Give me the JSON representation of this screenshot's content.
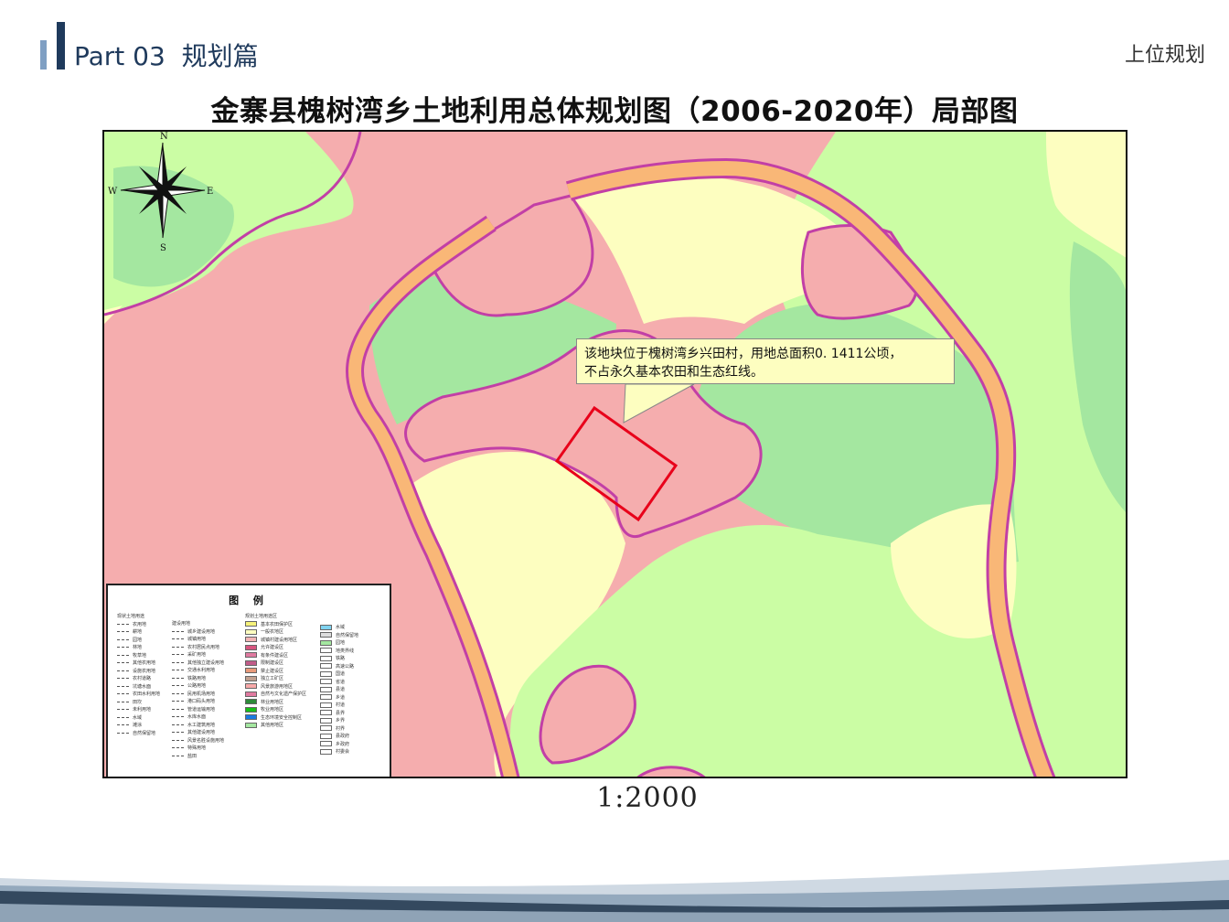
{
  "header": {
    "section": "Part 03",
    "section_title": "规划篇",
    "right_label": "上位规划"
  },
  "map": {
    "title": "金寨县槐树湾乡土地利用总体规划图（2006-2020年）局部图",
    "scale": "1:2000",
    "callout": {
      "line1": "该地块位于槐树湾乡兴田村，用地总面积0. 1411公顷，",
      "line2": "不占永久基本农田和生态红线。"
    },
    "compass": {
      "n": "N",
      "s": "S",
      "e": "E",
      "w": "W"
    },
    "colors": {
      "construction": "#f5adae",
      "construction_border": "#c23fa6",
      "road": "#f9b777",
      "farmland": "#fdfec0",
      "green_light": "#cbfda4",
      "green_mid": "#a4e7a0",
      "site_outline": "#e8001a"
    }
  },
  "legend": {
    "title": "图 例",
    "col1_header": "现状土地用途",
    "col1": [
      "农用地",
      "耕地",
      "园地",
      "林地",
      "牧草地",
      "其他农用地",
      "设施农用地",
      "农村道路",
      "坑塘水面",
      "农田水利用地",
      "田坎",
      "未利用地",
      "水域",
      "滩涂",
      "自然保留地"
    ],
    "col2_header": "建设用地",
    "col2": [
      "城乡建设用地",
      "城镇用地",
      "农村居民点用地",
      "采矿用地",
      "其他独立建设用地",
      "交通水利用地",
      "铁路用地",
      "公路用地",
      "民用机场用地",
      "港口码头用地",
      "管道运输用地",
      "水库水面",
      "水工建筑用地",
      "其他建设用地",
      "风景名胜设施用地",
      "特殊用地",
      "盐田"
    ],
    "col3_header": "规划土地用途区",
    "col3": [
      "基本农田保护区",
      "一般农地区",
      "城镇村建设用地区",
      "允许建设区",
      "有条件建设区",
      "限制建设区",
      "禁止建设区",
      "独立工矿区",
      "风景旅游用地区",
      "自然与文化遗产保护区",
      "林业用地区",
      "牧业用地区",
      "生态环境安全控制区",
      "其他用地区"
    ],
    "col4": [
      "水域",
      "自然保留地",
      "园地",
      "地类界线",
      "铁路",
      "高速公路",
      "国道",
      "省道",
      "县道",
      "乡道",
      "村道",
      "县界",
      "乡界",
      "村界",
      "县政府",
      "乡政府",
      "村委会"
    ]
  }
}
